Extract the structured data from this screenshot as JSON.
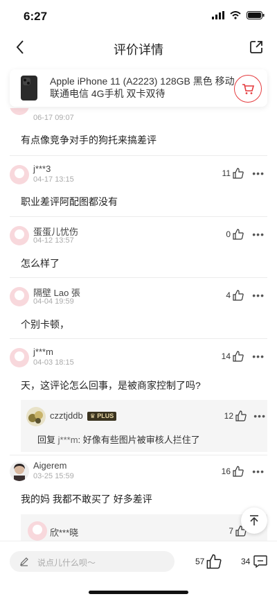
{
  "status_bar": {
    "time": "6:27"
  },
  "nav": {
    "title": "评价详情"
  },
  "product": {
    "name": "Apple iPhone 11 (A2223) 128GB 黑色 移动联通电信 4G手机 双卡双待"
  },
  "partial_top": {
    "date": "06-17 09:07",
    "text": "有点像竞争对手的狗托来搞差评"
  },
  "comments": [
    {
      "user": "j***3",
      "date": "04-17 13:15",
      "likes": "11",
      "text": "职业差评阿配图都没有"
    },
    {
      "user": "蛋蛋儿忧伤",
      "date": "04-12 13:57",
      "likes": "0",
      "text": "怎么样了"
    },
    {
      "user": "隔壁 Lao 張",
      "date": "04-04 19:59",
      "likes": "4",
      "text": "个别卡顿，"
    },
    {
      "user": "j***m",
      "date": "04-03 18:15",
      "likes": "14",
      "text": "天，这评论怎么回事，是被商家控制了吗?"
    },
    {
      "user": "Aigerem",
      "date": "03-25 15:59",
      "likes": "16",
      "text": "我的妈 我都不敢买了 好多差评"
    }
  ],
  "reply1": {
    "user": "czztjddb",
    "badge": "PLUS",
    "likes": "12",
    "prefix": "回复 ",
    "target": "j***m",
    "text": ": 好像有些图片被审核人拦住了"
  },
  "reply2": {
    "user": "欣***晓",
    "likes": "7"
  },
  "bottom": {
    "placeholder": "说点儿什么呗～",
    "likes": "57",
    "comments": "34"
  }
}
